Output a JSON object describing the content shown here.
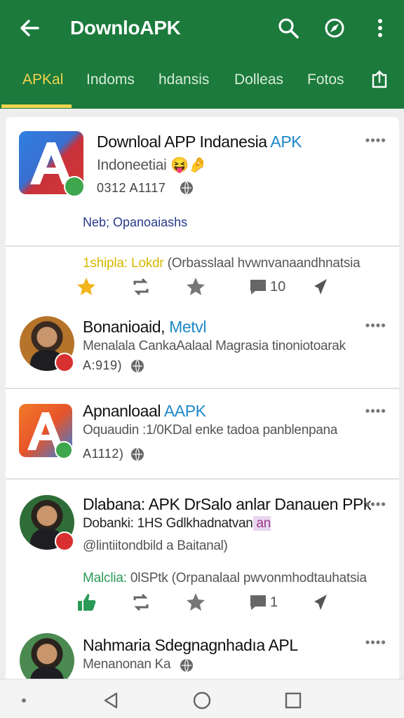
{
  "appbar": {
    "title": "DownloAPK",
    "icons": [
      "back-arrow-icon",
      "search-icon",
      "compass-icon",
      "more-vert-icon"
    ],
    "color": "#1b7a3c",
    "accent": "#f2d44e"
  },
  "tabs": [
    {
      "label": "APKal",
      "active": true
    },
    {
      "label": "Indoms",
      "active": false
    },
    {
      "label": "hdansis",
      "active": false
    },
    {
      "label": "Dolleas",
      "active": false
    },
    {
      "label": "Fotos",
      "active": false
    }
  ],
  "posts": [
    {
      "title_main": "Downloal APP Indanesia ",
      "title_accent": "APK",
      "subtitle": "Indoneetiai 😝🤌",
      "meta": "0312 A1117",
      "link": "Neb; Opanoaiashs",
      "activity_lead": "1shipla: Lokdr",
      "activity_rest": " (Orbasslaal hvwnvanaandhnatsia",
      "actions": {
        "comments": "10"
      }
    },
    {
      "title_main": "Bonanioaid, ",
      "title_accent": "Metvl",
      "line": "Menalala CankaAalaal Magrasia tinoniotoarak",
      "meta": "A:919)"
    },
    {
      "title_main": "Apnanloaal ",
      "title_accent": "AAPK",
      "line": "Oquaudin :1/0KDal enke tadoa panblenpana",
      "meta": "A1112)"
    },
    {
      "title_main": "Dlabana: APK DrSalo anlar Danauen PPk",
      "line": "Dobanki: 1HS Gdlkhadnatvan",
      "line_accent": " an",
      "handle": "@lintiitondbild a Baitanal)",
      "activity_lead": "Malclia: ",
      "activity_rest": "0lSPtk (Orpanalaal pwvonmhodtauhatsia",
      "actions": {
        "comments": "1"
      }
    },
    {
      "title_main": "Nahmaria Sdegnagnhadıa APL",
      "meta": "Menanonan Ka"
    }
  ]
}
